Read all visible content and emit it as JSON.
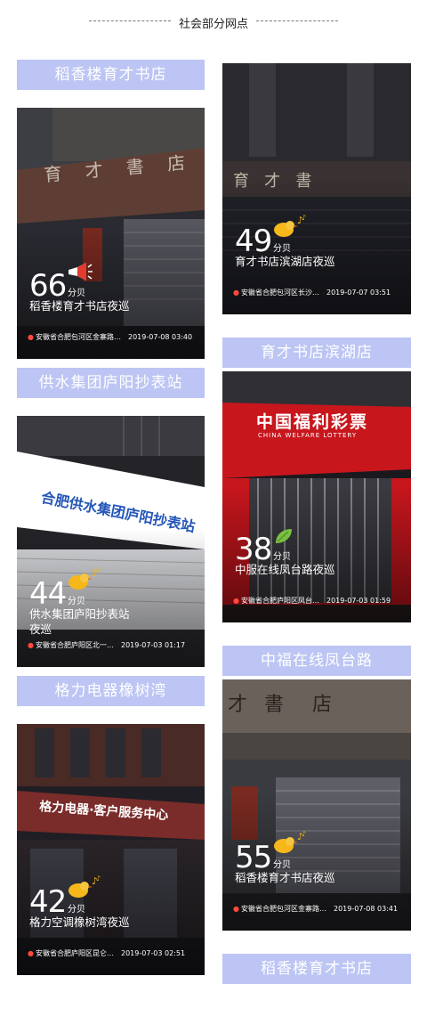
{
  "header": {
    "title": "社会部分网点"
  },
  "banners": {
    "b1": "稻香楼育才书店",
    "b2": "育才书店滨湖店",
    "b3": "供水集团庐阳抄表站",
    "b4": "中福在线凤台路",
    "b5": "格力电器橡树湾",
    "b6": "稻香楼育才书店"
  },
  "cards": {
    "c1": {
      "score": "66",
      "unit": "分贝",
      "title": "稻香楼育才书店夜巡",
      "location": "安徽省合肥包河区金寨路…",
      "time": "2019-07-08 03:40",
      "sign": "育 才 書 店"
    },
    "c2": {
      "score": "49",
      "unit": "分贝",
      "title": "育才书店滨湖店夜巡",
      "location": "安徽省合肥包河区长沙…",
      "time": "2019-07-07 03:51",
      "sign": "育   才   書"
    },
    "c3": {
      "score": "44",
      "unit": "分贝",
      "title": "供水集团庐阳抄表站夜巡",
      "location": "安徽省合肥庐阳区北一…",
      "time": "2019-07-03 01:17",
      "sign": "合肥供水集团庐阳抄表站"
    },
    "c4": {
      "score": "38",
      "unit": "分贝",
      "title": "中服在线凤台路夜巡",
      "location": "安徽省合肥庐阳区凤台…",
      "time": "2019-07-03 01:59",
      "sign": "中国福利彩票",
      "sign_en": "CHINA WELFARE LOTTERY"
    },
    "c5": {
      "score": "42",
      "unit": "分贝",
      "title": "格力空调橡树湾夜巡",
      "location": "安徽省合肥庐阳区昆仑…",
      "time": "2019-07-03 02:51",
      "sign": "格力电器·客户服务中心"
    },
    "c6": {
      "score": "55",
      "unit": "分贝",
      "title": "稻香楼育才书店夜巡",
      "location": "安徽省合肥包河区金寨路…",
      "time": "2019-07-08 03:41",
      "sign": "才 書  店"
    }
  },
  "colors": {
    "banner": "#bcc5f3",
    "pin": "#ff4a3c",
    "lottery_red": "#c8161d"
  }
}
